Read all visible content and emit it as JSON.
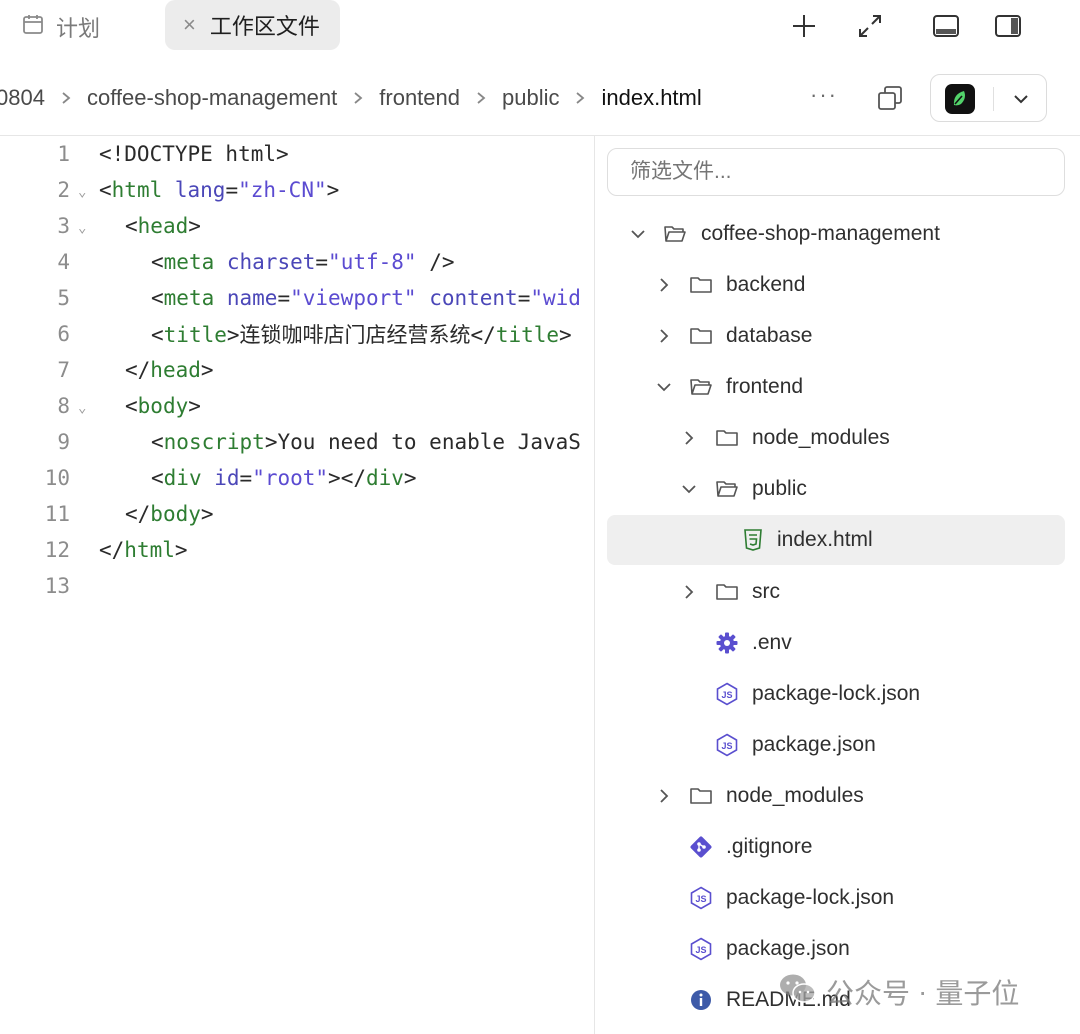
{
  "tabs": {
    "plan_label": "计划",
    "workspace_label": "工作区文件"
  },
  "breadcrumb": {
    "items": [
      "0804",
      "coffee-shop-management",
      "frontend",
      "public"
    ],
    "current": "index.html",
    "more": "···"
  },
  "editor": {
    "lines": [
      {
        "n": "1"
      },
      {
        "n": "2"
      },
      {
        "n": "3"
      },
      {
        "n": "4"
      },
      {
        "n": "5"
      },
      {
        "n": "6"
      },
      {
        "n": "7"
      },
      {
        "n": "8"
      },
      {
        "n": "9"
      },
      {
        "n": "10"
      },
      {
        "n": "11"
      },
      {
        "n": "12"
      },
      {
        "n": "13"
      }
    ],
    "code": {
      "l1": "<!DOCTYPE html>",
      "l2_open": "<",
      "l2_tag": "html",
      "l2_attr": " lang",
      "l2_eq": "=",
      "l2_val": "\"zh-CN\"",
      "l2_close": ">",
      "l3_open": "<",
      "l3_tag": "head",
      "l3_close": ">",
      "l4_open": "<",
      "l4_tag": "meta",
      "l4_attr": " charset",
      "l4_eq": "=",
      "l4_val": "\"utf-8\"",
      "l4_close": " />",
      "l5_open": "<",
      "l5_tag": "meta",
      "l5_attr1": " name",
      "l5_eq1": "=",
      "l5_val1": "\"viewport\"",
      "l5_attr2": " content",
      "l5_eq2": "=",
      "l5_val2": "\"wid",
      "l6_open": "<",
      "l6_tag": "title",
      "l6_close": ">",
      "l6_text": "连锁咖啡店门店经营系统",
      "l6_end_open": "</",
      "l6_end_tag": "title",
      "l6_end_close": ">",
      "l7_open": "</",
      "l7_tag": "head",
      "l7_close": ">",
      "l8_open": "<",
      "l8_tag": "body",
      "l8_close": ">",
      "l9_open": "<",
      "l9_tag": "noscript",
      "l9_close": ">",
      "l9_text": "You need to enable JavaS",
      "l10_open": "<",
      "l10_tag": "div",
      "l10_attr": " id",
      "l10_eq": "=",
      "l10_val": "\"root\"",
      "l10_mid": "></",
      "l10_tag2": "div",
      "l10_close": ">",
      "l11_open": "</",
      "l11_tag": "body",
      "l11_close": ">",
      "l12_open": "</",
      "l12_tag": "html",
      "l12_close": ">"
    }
  },
  "explorer": {
    "filter_placeholder": "筛选文件...",
    "tree": [
      {
        "label": "coffee-shop-management",
        "kind": "folder-open"
      },
      {
        "label": "backend",
        "kind": "folder"
      },
      {
        "label": "database",
        "kind": "folder"
      },
      {
        "label": "frontend",
        "kind": "folder-open"
      },
      {
        "label": "node_modules",
        "kind": "folder"
      },
      {
        "label": "public",
        "kind": "folder-open"
      },
      {
        "label": "index.html",
        "kind": "html-file"
      },
      {
        "label": "src",
        "kind": "folder"
      },
      {
        "label": ".env",
        "kind": "gear-file"
      },
      {
        "label": "package-lock.json",
        "kind": "js-file"
      },
      {
        "label": "package.json",
        "kind": "js-file"
      },
      {
        "label": "node_modules",
        "kind": "folder"
      },
      {
        "label": ".gitignore",
        "kind": "git-file"
      },
      {
        "label": "package-lock.json",
        "kind": "js-file"
      },
      {
        "label": "package.json",
        "kind": "js-file"
      },
      {
        "label": "README.md",
        "kind": "info-file"
      }
    ]
  },
  "watermark": {
    "source": "公众号",
    "dot": "·",
    "name": "量子位"
  },
  "colors": {
    "tag": "#2e7d32",
    "attr": "#4b47b8",
    "string": "#5b4bd1",
    "icon_purple": "#5a4fcf",
    "icon_green": "#2e7d32",
    "selected_row": "#efefef"
  }
}
